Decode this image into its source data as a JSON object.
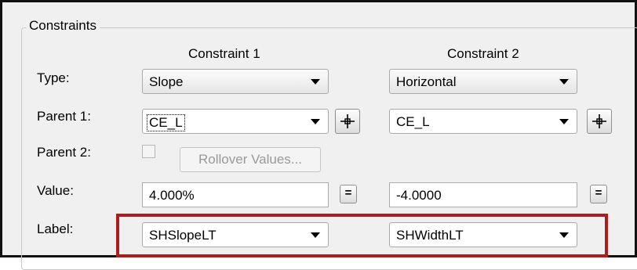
{
  "group": {
    "title": "Constraints"
  },
  "columns": {
    "c1": "Constraint 1",
    "c2": "Constraint 2"
  },
  "labels": {
    "type": "Type:",
    "parent1": "Parent 1:",
    "parent2": "Parent 2:",
    "value": "Value:",
    "label": "Label:"
  },
  "constraint1": {
    "type": "Slope",
    "parent1": "CE_L",
    "parent2_checked": false,
    "rollover_label": "Rollover Values...",
    "value": "4.000%",
    "equals": "=",
    "label": "SHSlopeLT"
  },
  "constraint2": {
    "type": "Horizontal",
    "parent1": "CE_L",
    "value": "-4.0000",
    "equals": "=",
    "label": "SHWidthLT"
  },
  "colors": {
    "highlight": "#b01c1c"
  },
  "icons": {
    "pick": "crosshair-icon",
    "dropdown": "chevron-down-icon"
  }
}
